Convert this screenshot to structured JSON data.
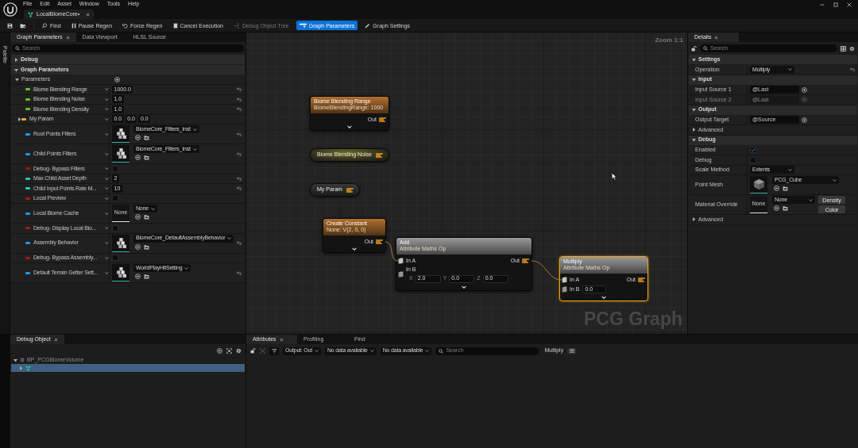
{
  "app": {
    "menu": [
      {
        "label": "File"
      },
      {
        "label": "Edit"
      },
      {
        "label": "Asset"
      },
      {
        "label": "Window"
      },
      {
        "label": "Tools"
      },
      {
        "label": "Help"
      }
    ],
    "document_tab": {
      "label": "LocalBiomeCore•"
    }
  },
  "toolbar": {
    "buttons": [
      {
        "label": "Find",
        "selected": false,
        "disabled": false
      },
      {
        "label": "Pause Regen",
        "selected": false,
        "disabled": false
      },
      {
        "label": "Force Regen",
        "selected": false,
        "disabled": false
      },
      {
        "label": "Cancel Execution",
        "selected": false,
        "disabled": false
      },
      {
        "label": "Debug Object Tree",
        "selected": false,
        "disabled": true
      },
      {
        "label": "Graph Parameters",
        "selected": true,
        "disabled": false
      },
      {
        "label": "Graph Settings",
        "selected": false,
        "disabled": false
      }
    ]
  },
  "side_tab": {
    "label": "Palette"
  },
  "parameters_panel": {
    "tabs": [
      {
        "label": "Graph Parameters",
        "selected": true
      },
      {
        "label": "Data Viewport",
        "selected": false
      },
      {
        "label": "HLSL Source",
        "selected": false
      }
    ],
    "search": {
      "placeholder": "Search"
    },
    "categories": [
      {
        "label": "Debug",
        "expanded": false
      },
      {
        "label": "Graph Parameters",
        "expanded": true,
        "groups": [
          {
            "label": "Parameters",
            "expanded": true,
            "params": [
              {
                "name": "Biome Blending Range",
                "kind": "number",
                "color": "#5fbf2a",
                "values": [
                  "1000.0"
                ],
                "resettable": true
              },
              {
                "name": "Biome Blending Noise",
                "kind": "number",
                "color": "#5fbf2a",
                "values": [
                  "1.0"
                ],
                "resettable": true
              },
              {
                "name": "Biome Blending Density",
                "kind": "number",
                "color": "#5fbf2a",
                "values": [
                  "1.0"
                ],
                "resettable": true
              },
              {
                "name": "My Param",
                "kind": "vector",
                "color": "#e2a928",
                "values": [
                  "0.0",
                  "0.0",
                  "0.0"
                ],
                "expanded": false,
                "resettable": false
              },
              {
                "name": "Root Points Filters",
                "kind": "asset",
                "color": "#2398e0",
                "value": "BiomeCore_Filters_Inst",
                "resettable": true
              },
              {
                "name": "Child Points Filters",
                "kind": "asset",
                "color": "#2398e0",
                "value": "BiomeCore_Filters_Inst",
                "resettable": true
              },
              {
                "name": "Debug- Bypass Filters",
                "kind": "bool",
                "color": "#a31616",
                "checked": false,
                "resettable": false
              },
              {
                "name": "Max Child Asset Depth",
                "kind": "number",
                "color": "#2cc7a4",
                "values": [
                  "2"
                ],
                "resettable": true
              },
              {
                "name": "Child Input Points Rate M...",
                "kind": "number",
                "color": "#2cc7a4",
                "values": [
                  "10"
                ],
                "resettable": true
              },
              {
                "name": "Local Preview",
                "kind": "bool",
                "color": "#a31616",
                "checked": false,
                "resettable": false
              },
              {
                "name": "Local Biome Cache",
                "kind": "asset",
                "color": "#2398e0",
                "value": "None",
                "thumbnail_text": "None",
                "resettable": false
              },
              {
                "name": "Debug- Display Local Bio...",
                "kind": "bool",
                "color": "#a31616",
                "checked": false,
                "resettable": false
              },
              {
                "name": "Assembly Behavior",
                "kind": "asset",
                "color": "#2398e0",
                "value": "BiomeCore_DefaultAssemblyBehavior",
                "resettable": true
              },
              {
                "name": "Debug- Bypass Assembly...",
                "kind": "bool",
                "color": "#a31616",
                "checked": false,
                "resettable": false
              },
              {
                "name": "Default Terrain Getter Sett...",
                "kind": "asset",
                "color": "#2398e0",
                "value": "WorldPlayHitSetting",
                "resettable": true
              }
            ]
          }
        ]
      }
    ]
  },
  "graph": {
    "zoom_label": "Zoom 1:1",
    "graph_label": "PCG Graph",
    "nodes": [
      {
        "kind": "full",
        "title": "Biome Blending Range",
        "subtitle": "BiomeBlendingRange: 1000",
        "color": "#b2702e",
        "selected": false,
        "outputs": [
          {
            "label": "Out"
          }
        ]
      },
      {
        "kind": "compact",
        "title": "Biome Blending Noise",
        "highlighted": true
      },
      {
        "kind": "compact",
        "title": "My Param",
        "highlighted": false
      },
      {
        "kind": "full",
        "title": "Create Constant",
        "subtitle": "None: V(2, 0, 0)",
        "color": "#b2702e",
        "selected": false,
        "outputs": [
          {
            "label": "Out"
          }
        ]
      },
      {
        "kind": "full",
        "title": "Add",
        "subtitle": "Attribute Maths Op",
        "color": "#9a9a9a",
        "selected": false,
        "inputs": [
          {
            "label": "In A",
            "connected": true
          },
          {
            "label": "In B",
            "connected": false,
            "fields": [
              {
                "axis": "X",
                "value": "2.0"
              },
              {
                "axis": "Y",
                "value": "0.0"
              },
              {
                "axis": "Z",
                "value": "0.0"
              }
            ]
          }
        ],
        "outputs": [
          {
            "label": "Out"
          }
        ]
      },
      {
        "kind": "full",
        "title": "Multiply",
        "subtitle": "Attribute Maths Op",
        "color": "#9a9a9a",
        "selected": true,
        "inputs": [
          {
            "label": "In A",
            "connected": true
          },
          {
            "label": "In B",
            "connected": false,
            "fields": [
              {
                "value": "0.0"
              }
            ]
          }
        ],
        "outputs": [
          {
            "label": "Out"
          }
        ]
      }
    ]
  },
  "details": {
    "tab": {
      "label": "Details"
    },
    "search": {
      "placeholder": "Search"
    },
    "sections": [
      {
        "kind": "category",
        "label": "Settings",
        "expanded": true,
        "rows": [
          {
            "kind": "dropdown",
            "label": "Operation",
            "value": "Multiply",
            "resettable": true,
            "disabled": false
          }
        ]
      },
      {
        "kind": "category",
        "label": "Input",
        "expanded": true,
        "rows": [
          {
            "kind": "text",
            "label": "Input Source 1",
            "value": "@Last",
            "resettable": false,
            "disabled": false
          },
          {
            "kind": "text",
            "label": "Input Source 2",
            "value": "@Last",
            "resettable": false,
            "disabled": true
          }
        ]
      },
      {
        "kind": "category",
        "label": "Output",
        "expanded": true,
        "rows": [
          {
            "kind": "text",
            "label": "Output Target",
            "value": "@Source",
            "resettable": false,
            "disabled": false
          }
        ]
      },
      {
        "kind": "group",
        "label": "Advanced",
        "expanded": false
      },
      {
        "kind": "category",
        "label": "Debug",
        "expanded": true,
        "rows": [
          {
            "kind": "checkbox",
            "label": "Enabled",
            "checked": true,
            "resettable": false,
            "disabled": false
          },
          {
            "kind": "checkbox",
            "label": "Debug",
            "checked": false,
            "resettable": false,
            "disabled": false
          },
          {
            "kind": "dropdown",
            "label": "Scale Method",
            "value": "Extents",
            "resettable": false,
            "disabled": false
          },
          {
            "kind": "asset",
            "label": "Point Mesh",
            "value": "PCG_Cube",
            "resettable": false,
            "disabled": false
          },
          {
            "kind": "asset",
            "label": "Material Override",
            "value": "None",
            "thumbnail_text": "None",
            "buttons": [
              {
                "label": "Density"
              },
              {
                "label": "Color"
              }
            ],
            "resettable": false,
            "disabled": false
          }
        ]
      },
      {
        "kind": "group",
        "label": "Advanced",
        "expanded": false
      }
    ]
  },
  "debug_object": {
    "tab": {
      "label": "Debug Object"
    },
    "tree": [
      {
        "label": "BP_PCGBiomeVolume",
        "expanded": true,
        "selected": false,
        "children": [
          {
            "expanded": false,
            "selected": true
          }
        ]
      }
    ]
  },
  "attributes": {
    "tabs": [
      {
        "label": "Attributes",
        "selected": true
      },
      {
        "label": "Profiling",
        "selected": false
      },
      {
        "label": "Find",
        "selected": false
      }
    ],
    "filters": [
      {
        "label": "Output: Out"
      },
      {
        "label": "No data available"
      },
      {
        "label": "No data available"
      }
    ],
    "search": {
      "placeholder": "Search"
    },
    "node_label": "Multiply"
  }
}
